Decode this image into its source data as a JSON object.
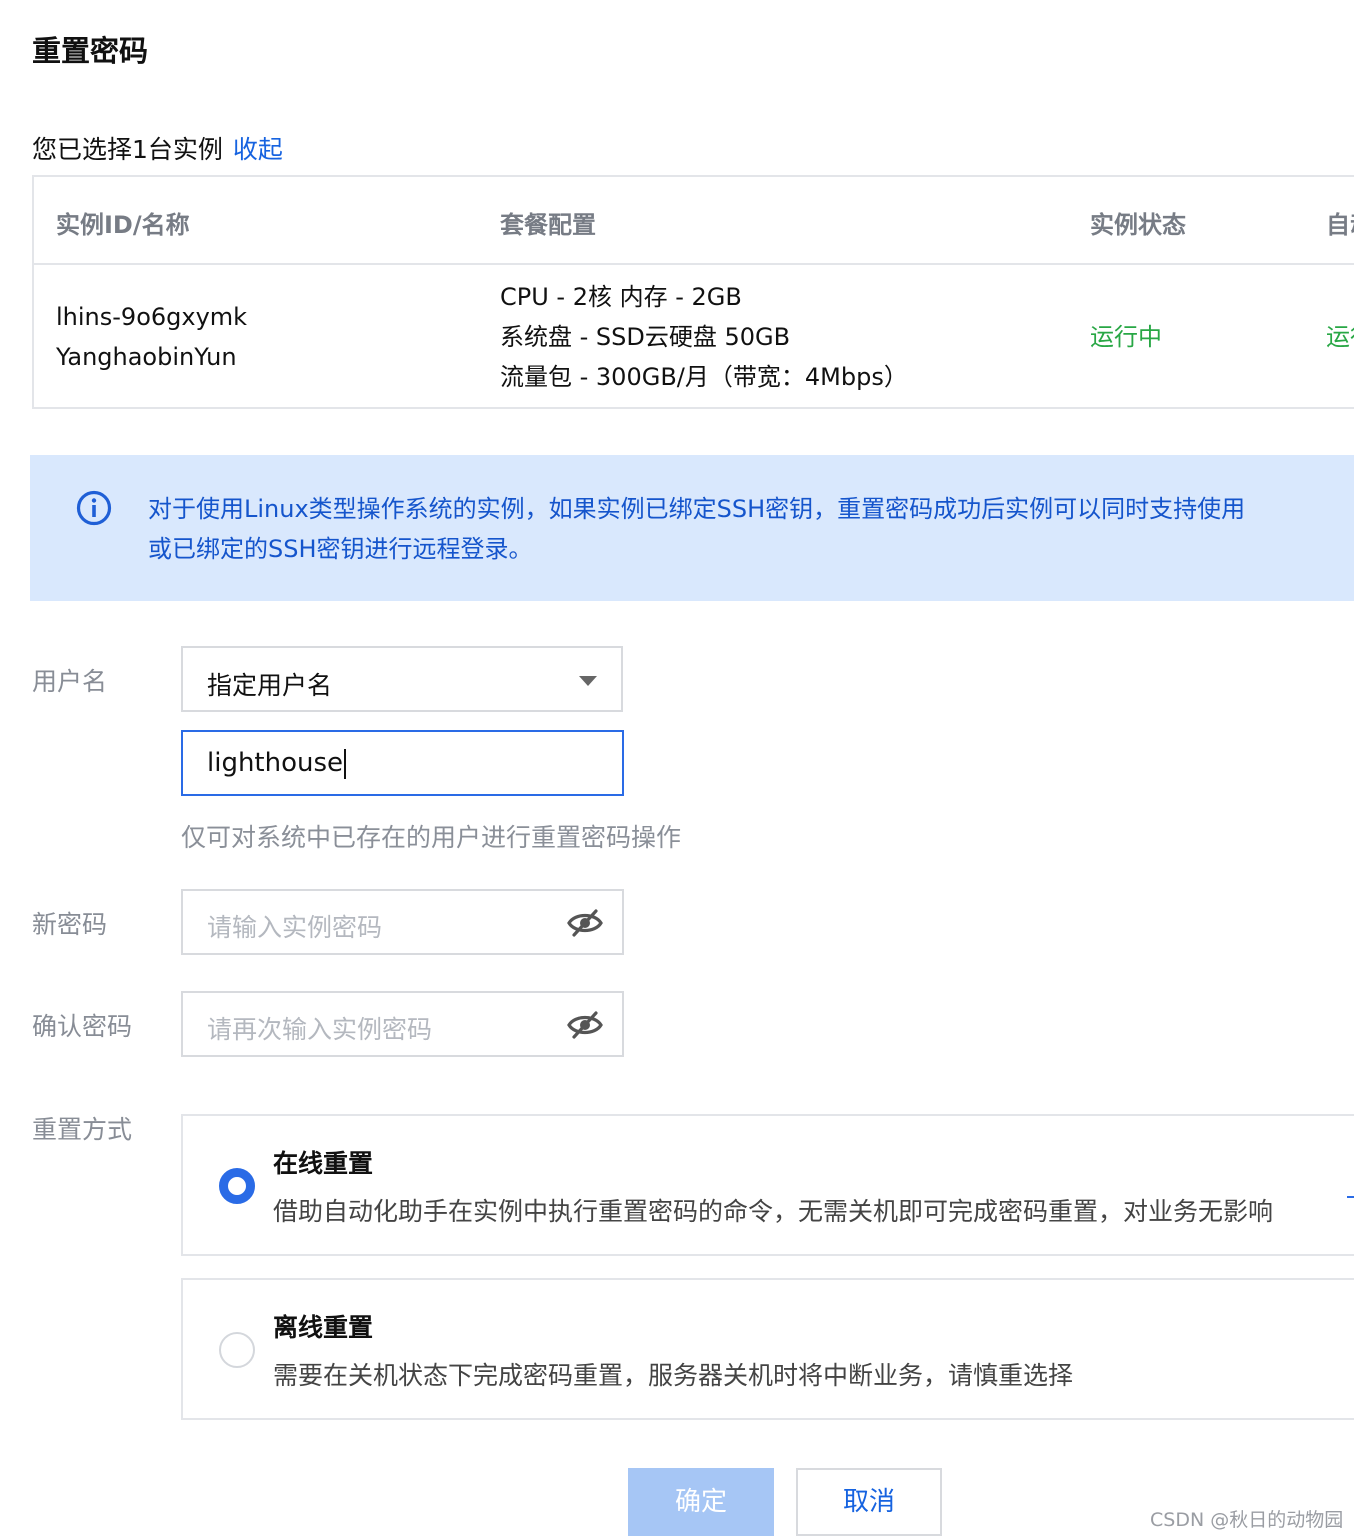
{
  "title": "重置密码",
  "selection": {
    "text": "您已选择1台实例",
    "toggle_label": "收起"
  },
  "table": {
    "headers": [
      "实例ID/名称",
      "套餐配置",
      "实例状态",
      "自动"
    ],
    "row": {
      "id": "lhins-9o6gxymk",
      "name": "YanghaobinYun",
      "config": [
        "CPU - 2核 内存 - 2GB",
        "系统盘 - SSD云硬盘 50GB",
        "流量包 - 300GB/月（带宽：4Mbps）"
      ],
      "status": "运行中",
      "auto_status": "运行中"
    }
  },
  "notice": {
    "icon": "info-circle-icon",
    "lines": [
      "对于使用Linux类型操作系统的实例，如果实例已绑定SSH密钥，重置密码成功后实例可以同时支持使用",
      "或已绑定的SSH密钥进行远程登录。"
    ]
  },
  "form": {
    "username_label": "用户名",
    "username_mode": "指定用户名",
    "username_value": "lighthouse",
    "username_hint": "仅可对系统中已存在的用户进行重置密码操作",
    "new_password_label": "新密码",
    "new_password_placeholder": "请输入实例密码",
    "confirm_password_label": "确认密码",
    "confirm_password_placeholder": "请再次输入实例密码",
    "reset_method_label": "重置方式"
  },
  "options": [
    {
      "title": "在线重置",
      "desc": "借助自动化助手在实例中执行重置密码的命令，无需关机即可完成密码重置，对业务无影响",
      "selected": true
    },
    {
      "title": "离线重置",
      "desc": "需要在关机状态下完成密码重置，服务器关机时将中断业务，请慎重选择",
      "selected": false
    }
  ],
  "buttons": {
    "confirm": "确定",
    "cancel": "取消"
  },
  "watermark": "CSDN @秋日的动物园",
  "colors": {
    "primary": "#2a6be6",
    "link": "#1663e0",
    "success": "#28a745",
    "notice_bg": "#d9e8fd",
    "disabled_primary": "#a6c6f5"
  }
}
